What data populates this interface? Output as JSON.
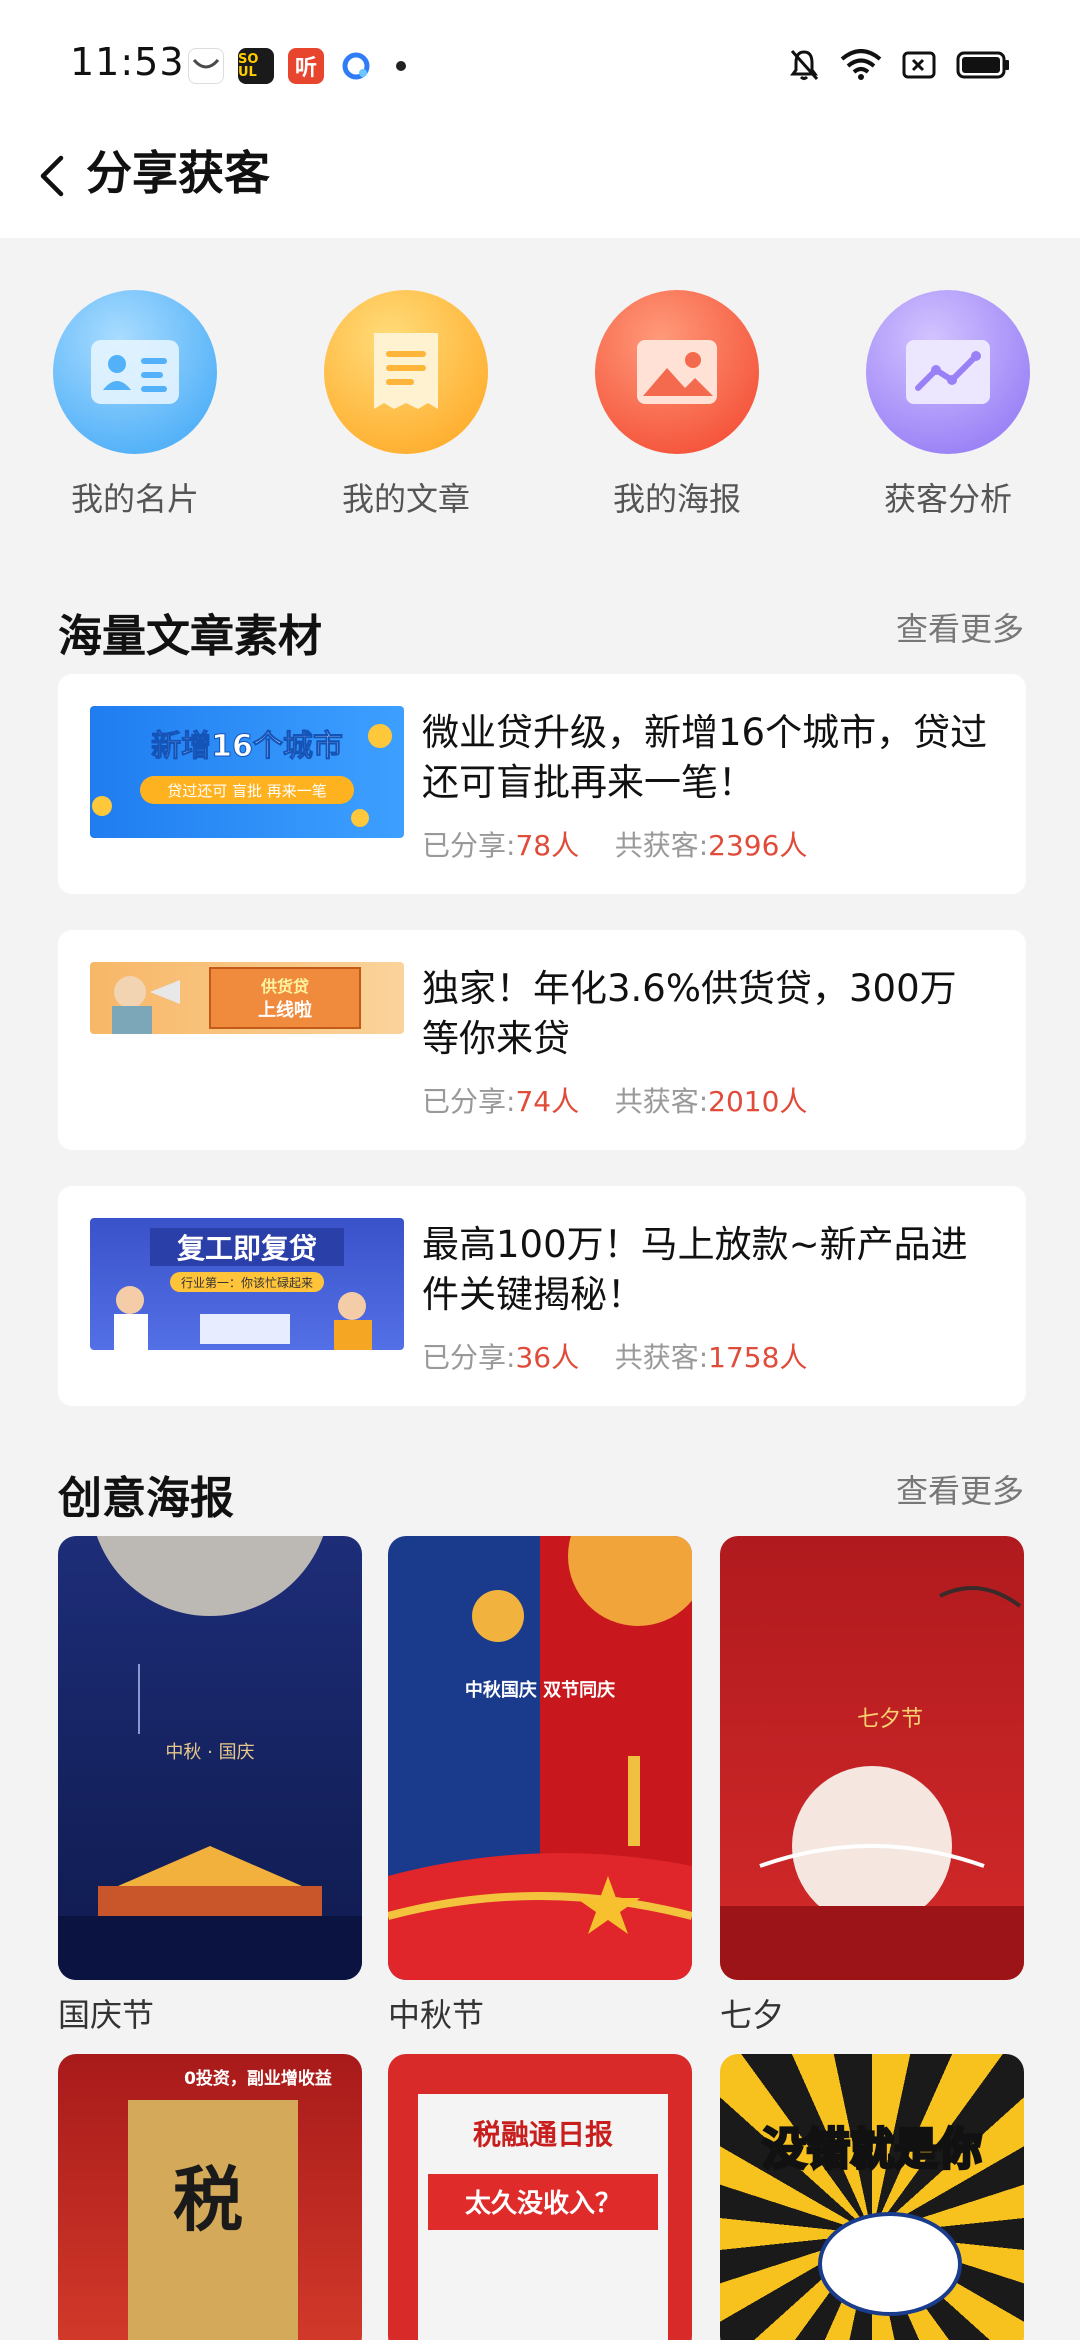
{
  "status_bar": {
    "time": "11:53",
    "apps": [
      {
        "icon": "app-icon-1",
        "color": "#ffffff"
      },
      {
        "icon": "soul-app-icon",
        "label": "SO UL",
        "color": "#1a1a1a"
      },
      {
        "icon": "listen-app-icon",
        "label": "听",
        "color": "#e8452f"
      },
      {
        "icon": "browser-app-icon",
        "color": "#2f7cf6"
      }
    ],
    "indicators": [
      "mute-icon",
      "wifi-icon",
      "sim-icon",
      "battery-icon"
    ]
  },
  "header": {
    "title": "分享获客",
    "back_icon": "back-arrow-icon"
  },
  "quick_actions": [
    {
      "label": "我的名片",
      "icon": "business-card-icon",
      "color_from": "#8fd2ff",
      "color_to": "#36a3f5"
    },
    {
      "label": "我的文章",
      "icon": "article-icon",
      "color_from": "#ffd56b",
      "color_to": "#ffa71f"
    },
    {
      "label": "我的海报",
      "icon": "poster-image-icon",
      "color_from": "#ff9370",
      "color_to": "#f5462d"
    },
    {
      "label": "获客分析",
      "icon": "analytics-icon",
      "color_from": "#c8b5ff",
      "color_to": "#8f72f5"
    }
  ],
  "articles_section": {
    "title": "海量文章素材",
    "more": "查看更多",
    "shared_label": "已分享:",
    "acquired_label": "共获客:",
    "items": [
      {
        "title": "微业贷升级，新增16个城市，贷过还可盲批再来一笔！",
        "shared": "78人",
        "acquired": "2396人",
        "thumb_text": "新增16个城市",
        "thumb_sub": "贷过还可 盲批 再来一笔"
      },
      {
        "title": "独家！年化3.6%供货贷，300万等你来贷",
        "shared": "74人",
        "acquired": "2010人",
        "thumb_text": "供货贷",
        "thumb_sub": "上线啦"
      },
      {
        "title": "最高100万！马上放款~新产品进件关键揭秘！",
        "shared": "36人",
        "acquired": "1758人",
        "thumb_text": "复工即复贷",
        "thumb_sub": "行业第一：你该忙碌起来"
      }
    ]
  },
  "posters_section": {
    "title": "创意海报",
    "more": "查看更多",
    "items": [
      {
        "label": "国庆节",
        "text": "中秋 · 国庆"
      },
      {
        "label": "中秋节",
        "text": "中秋国庆 双节同庆"
      },
      {
        "label": "七夕",
        "text": "七夕节"
      },
      {
        "label": "",
        "text": "0投资，副业增收益"
      },
      {
        "label": "",
        "text": "太久没收入？"
      },
      {
        "label": "",
        "text": "没错就是你"
      }
    ]
  }
}
